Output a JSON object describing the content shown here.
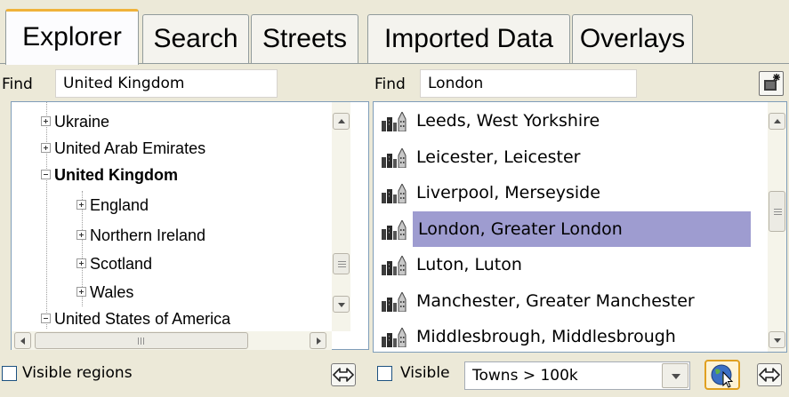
{
  "tabs": [
    {
      "label": "Explorer",
      "active": true
    },
    {
      "label": "Search",
      "active": false
    },
    {
      "label": "Streets",
      "active": false
    },
    {
      "label": "Imported Data",
      "active": false
    },
    {
      "label": "Overlays",
      "active": false
    }
  ],
  "left": {
    "find_label": "Find",
    "find_value": "United Kingdom",
    "tree": [
      {
        "label": "Ukraine",
        "expander": "plus",
        "bold": false
      },
      {
        "label": "United Arab Emirates",
        "expander": "plus",
        "bold": false
      },
      {
        "label": "United Kingdom",
        "expander": "minus",
        "bold": true
      },
      {
        "label": "England",
        "expander": "plus",
        "bold": false
      },
      {
        "label": "Northern Ireland",
        "expander": "plus",
        "bold": false
      },
      {
        "label": "Scotland",
        "expander": "plus",
        "bold": false
      },
      {
        "label": "Wales",
        "expander": "plus",
        "bold": false
      },
      {
        "label": "United States of America",
        "expander": "minus",
        "bold": false
      }
    ],
    "visible_regions_label": "Visible regions",
    "visible_regions_checked": false
  },
  "right": {
    "find_label": "Find",
    "find_value": "London",
    "cities": [
      {
        "label": "Leeds, West Yorkshire",
        "selected": false
      },
      {
        "label": "Leicester, Leicester",
        "selected": false
      },
      {
        "label": "Liverpool, Merseyside",
        "selected": false
      },
      {
        "label": "London, Greater London",
        "selected": true
      },
      {
        "label": "Luton, Luton",
        "selected": false
      },
      {
        "label": "Manchester, Greater Manchester",
        "selected": false
      },
      {
        "label": "Middlesbrough, Middlesbrough",
        "selected": false
      }
    ],
    "visible_label": "Visible",
    "visible_checked": false,
    "filter_value": "Towns > 100k"
  },
  "icons": {
    "new": "new-item-icon",
    "arrow": "transfer-arrows-icon",
    "globe": "globe-cursor-icon",
    "city": "city-buildings-icon",
    "expander_plus": "plus-box-icon",
    "expander_minus": "minus-box-icon"
  },
  "colors": {
    "window_bg": "#ece9d8",
    "selection": "#9e9cd0",
    "active_tab_accent": "#f0b23a",
    "panel_border": "#7f9db9"
  }
}
